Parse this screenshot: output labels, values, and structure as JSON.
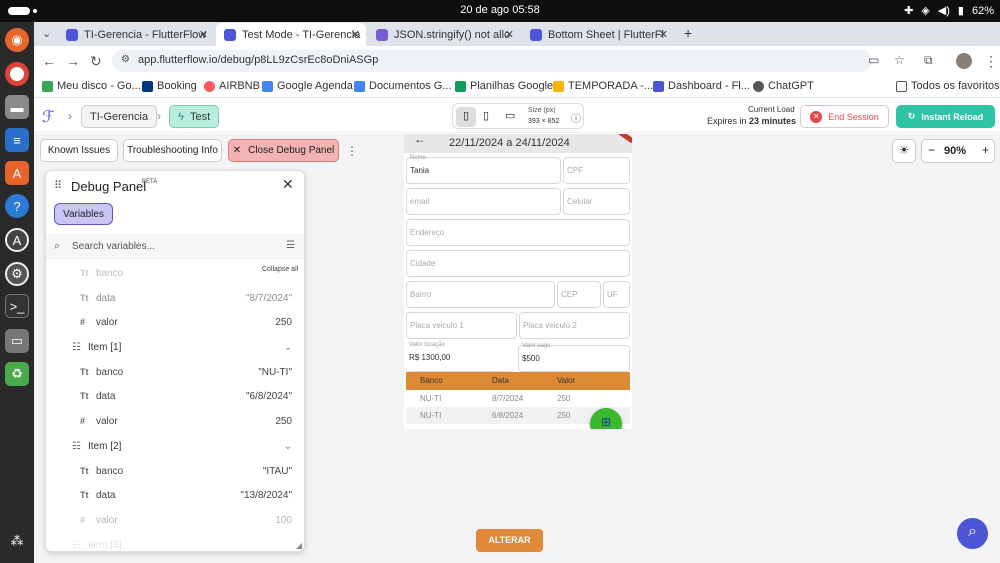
{
  "os": {
    "date_time": "20 de ago  05:58",
    "battery": "62%"
  },
  "tabs": [
    {
      "label": "TI-Gerencia - FlutterFlow"
    },
    {
      "label": "Test Mode - TI-Gerencia"
    },
    {
      "label": "JSON.stringify() not allo"
    },
    {
      "label": "Bottom Sheet | FlutterFl"
    }
  ],
  "url": "app.flutterflow.io/debug/p8LL9zCsrEc8oDniASGp",
  "bookmarks": [
    "Meu disco - Go...",
    "Booking",
    "AIRBNB",
    "Google Agenda",
    "Documentos G...",
    "Planilhas Google",
    "TEMPORADA -...",
    "Dashboard - Fl...",
    "ChatGPT",
    "Todos os favoritos"
  ],
  "ff": {
    "project": "TI-Gerencia",
    "mode": "Test",
    "size_label": "Size (px)",
    "size_value": "393 × 852",
    "current_load": "Current Load",
    "expires_prefix": "Expires in",
    "expires_value": "23 minutes",
    "end_session": "End Session",
    "instant_reload": "Instant Reload",
    "known_issues": "Known Issues",
    "troubleshooting": "Troubleshooting Info",
    "close_debug": "Close Debug Panel",
    "zoom": "90%"
  },
  "debug": {
    "title": "Debug Panel",
    "beta": "BETA",
    "variables_tab": "Variables",
    "search_placeholder": "Search variables...",
    "collapse_all": "Collapse all",
    "rows": [
      {
        "type": "Tt",
        "key": "banco",
        "value": ""
      },
      {
        "type": "Tt",
        "key": "data",
        "value": "\"8/7/2024\""
      },
      {
        "type": "#",
        "key": "valor",
        "value": "250"
      },
      {
        "type": "item",
        "key": "Item [1]",
        "value": ""
      },
      {
        "type": "Tt",
        "key": "banco",
        "value": "\"NU-TI\""
      },
      {
        "type": "Tt",
        "key": "data",
        "value": "\"6/8/2024\""
      },
      {
        "type": "#",
        "key": "valor",
        "value": "250"
      },
      {
        "type": "item",
        "key": "Item [2]",
        "value": ""
      },
      {
        "type": "Tt",
        "key": "banco",
        "value": "\"ITAU\""
      },
      {
        "type": "Tt",
        "key": "data",
        "value": "\"13/8/2024\""
      },
      {
        "type": "#",
        "key": "valor",
        "value": "100"
      },
      {
        "type": "item",
        "key": "Item [3]",
        "value": ""
      }
    ]
  },
  "app": {
    "period": "22/11/2024 a 24/11/2024",
    "name_label": "Nome",
    "name_value": "Tania",
    "cpf": "CPF",
    "email": "email",
    "celular": "Celular",
    "endereco": "Endereço",
    "cidade": "Cidade",
    "bairro": "Bairro",
    "cep": "CEP",
    "uf": "UF",
    "placa1": "Placa veiculo 1",
    "placa2": "Placa veiculo 2",
    "valor_locacao_label": "Valor locação",
    "valor_locacao": "R$ 1300,00",
    "valor_pago_label": "Valor pago",
    "valor_pago": "$500",
    "table_headers": [
      "Banco",
      "Data",
      "Valor"
    ],
    "table_rows": [
      [
        "NU-TI",
        "8/7/2024",
        "250"
      ],
      [
        "NU-TI",
        "6/8/2024",
        "250"
      ]
    ],
    "alterar": "ALTERAR"
  },
  "colors": {
    "accent": "#2ec4a6",
    "debug_close": "#f3b3b3",
    "fab": "#3cb82e",
    "table_header": "#dc8a33",
    "alterar": "#e0893a"
  }
}
